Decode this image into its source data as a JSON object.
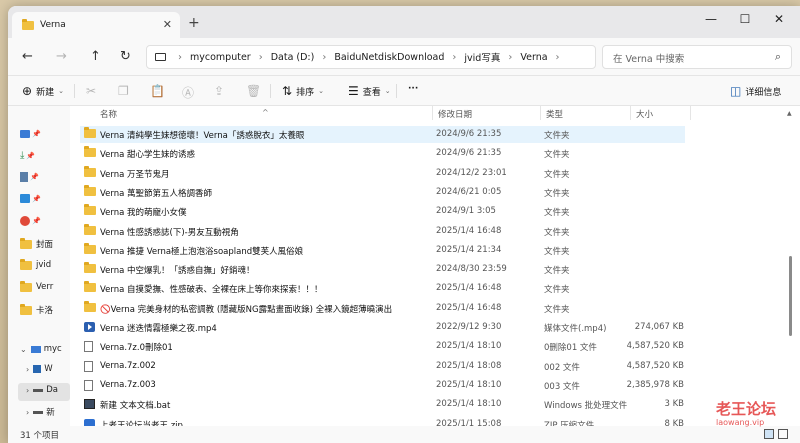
{
  "tab": {
    "title": "Verna",
    "close": "✕",
    "new": "+"
  },
  "window": {
    "minimize": "—",
    "maximize": "☐",
    "close": "✕"
  },
  "nav": {
    "back": "←",
    "forward": "→",
    "up": "↑",
    "refresh": "↻"
  },
  "breadcrumbs": [
    "mycomputer",
    "Data (D:)",
    "BaiduNetdiskDownload",
    "jvid写真",
    "Verna"
  ],
  "search": {
    "placeholder": "在 Verna 中搜索"
  },
  "toolbar": {
    "new": "新建",
    "sort": "排序",
    "view": "查看",
    "more": "···",
    "details": "详细信息"
  },
  "columns": {
    "name": "名称",
    "date": "修改日期",
    "type": "类型",
    "size": "大小"
  },
  "sidebar": [
    {
      "label": "",
      "icon": "desktop-icon"
    },
    {
      "label": "",
      "icon": "download-icon"
    },
    {
      "label": "",
      "icon": "documents-icon"
    },
    {
      "label": "",
      "icon": "pictures-icon"
    },
    {
      "label": "",
      "icon": "music-icon"
    },
    {
      "label": "封面",
      "icon": "folder-icon"
    },
    {
      "label": "jvid",
      "icon": "folder-icon"
    },
    {
      "label": "Verr",
      "icon": "folder-icon"
    },
    {
      "label": "卡洛",
      "icon": "folder-icon"
    },
    {
      "label": "myc",
      "icon": "pc-icon"
    },
    {
      "label": "W",
      "icon": "drive-icon"
    },
    {
      "label": "Da",
      "icon": "drive-icon"
    },
    {
      "label": "新",
      "icon": "drive-icon"
    }
  ],
  "files": [
    {
      "name": "Verna 清純學生妹想徳壞！Verna「誘惑脫衣」太養眼",
      "date": "2024/9/6 21:35",
      "type": "文件夹",
      "size": "",
      "icon": "folder"
    },
    {
      "name": "Verna 甜心学生妹的诱惑",
      "date": "2024/9/6 21:35",
      "type": "文件夹",
      "size": "",
      "icon": "folder"
    },
    {
      "name": "Verna 万圣节鬼月",
      "date": "2024/12/2 23:01",
      "type": "文件夹",
      "size": "",
      "icon": "folder"
    },
    {
      "name": "Verna 萬聖節第五人格調香師",
      "date": "2024/6/21 0:05",
      "type": "文件夹",
      "size": "",
      "icon": "folder"
    },
    {
      "name": "Verna 我的萌寵小女僕",
      "date": "2024/9/1 3:05",
      "type": "文件夹",
      "size": "",
      "icon": "folder"
    },
    {
      "name": "Verna 性感誘惑誌(下)-男友互動視角",
      "date": "2025/1/4 16:48",
      "type": "文件夹",
      "size": "",
      "icon": "folder"
    },
    {
      "name": "Verna 推捷 Verna極上泡泡浴soapland雙芙人風俗娘",
      "date": "2025/1/4 21:34",
      "type": "文件夹",
      "size": "",
      "icon": "folder"
    },
    {
      "name": "Verna 中空爆乳！「誘惑自撫」好銷魂！",
      "date": "2024/8/30 23:59",
      "type": "文件夹",
      "size": "",
      "icon": "folder"
    },
    {
      "name": "Verna 自摸愛撫、性感破表、全裸在床上等你來探索！！！",
      "date": "2025/1/4 16:48",
      "type": "文件夹",
      "size": "",
      "icon": "folder"
    },
    {
      "name": "🚫Verna 完美身材的私密調教 (隱藏版NG露點畫面收錄) 全裸入鏡超薄曉演出",
      "date": "2025/1/4 16:48",
      "type": "文件夹",
      "size": "",
      "icon": "folder"
    },
    {
      "name": "Verna 迷迭情霧極樂之夜.mp4",
      "date": "2022/9/12 9:30",
      "type": "媒体文件(.mp4)",
      "size": "274,067 KB",
      "icon": "mp4"
    },
    {
      "name": "Verna.7z.0刪除01",
      "date": "2025/1/4 18:10",
      "type": "0删除01 文件",
      "size": "4,587,520 KB",
      "icon": "file"
    },
    {
      "name": "Verna.7z.002",
      "date": "2025/1/4 18:08",
      "type": "002 文件",
      "size": "4,587,520 KB",
      "icon": "file"
    },
    {
      "name": "Verna.7z.003",
      "date": "2025/1/4 18:10",
      "type": "003 文件",
      "size": "2,385,978 KB",
      "icon": "file"
    },
    {
      "name": "新建 文本文档.bat",
      "date": "2025/1/4 18:10",
      "type": "Windows 批处理文件",
      "size": "3 KB",
      "icon": "bat"
    },
    {
      "name": "上老王论坛当老王.zip",
      "date": "2025/1/1 15:08",
      "type": "ZIP 压缩文件",
      "size": "8 KB",
      "icon": "zip"
    }
  ],
  "status": {
    "count": "31 个项目"
  },
  "watermark": {
    "main": "老王论坛",
    "sub": "laowang.vip"
  }
}
